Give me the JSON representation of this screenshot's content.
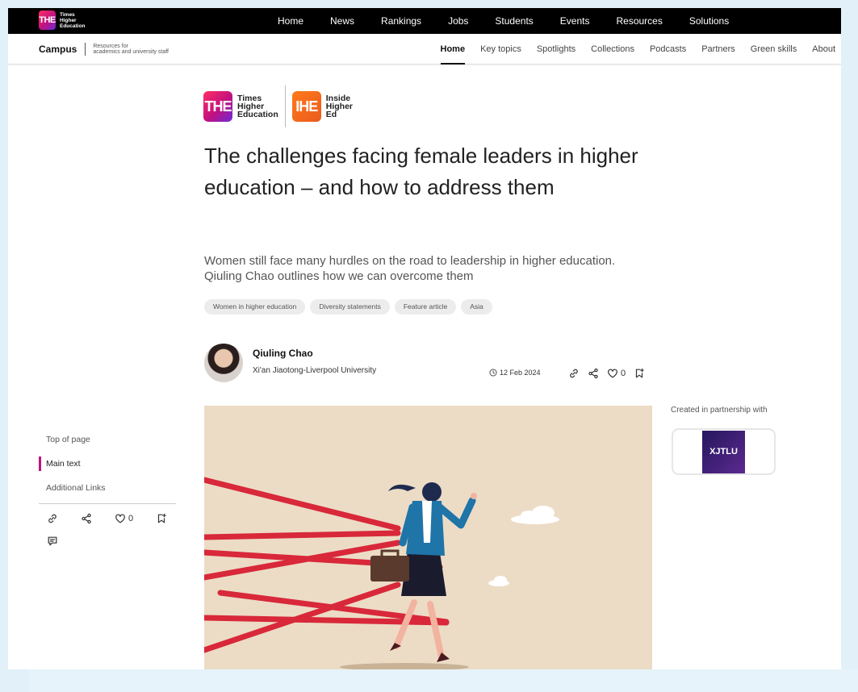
{
  "topbar": {
    "logo_mark": "THE",
    "logo_lines": [
      "Times",
      "Higher",
      "Education"
    ],
    "nav": [
      "Home",
      "News",
      "Rankings",
      "Jobs",
      "Students",
      "Events",
      "Resources",
      "Solutions"
    ]
  },
  "subbar": {
    "campus": "Campus",
    "tagline": [
      "Resources for",
      "academics and university staff"
    ],
    "nav": [
      "Home",
      "Key topics",
      "Spotlights",
      "Collections",
      "Podcasts",
      "Partners",
      "Green skills",
      "About"
    ],
    "active": "Home"
  },
  "article": {
    "logos": {
      "the_mark": "THE",
      "the_words": [
        "Times",
        "Higher",
        "Education"
      ],
      "ihe_mark": "IHE",
      "ihe_words": [
        "Inside",
        "Higher",
        "Ed"
      ]
    },
    "title": "The challenges facing female leaders in higher education – and how to address them",
    "standfirst": "Women still face many hurdles on the road to leadership in higher education. Qiuling Chao outlines how we can overcome them",
    "tags": [
      "Women in higher education",
      "Diversity statements",
      "Feature article",
      "Asia"
    ],
    "author": {
      "name": "Qiuling Chao",
      "institution": "Xi'an Jiaotong-Liverpool University"
    },
    "date": "12 Feb 2024",
    "like_count": "0"
  },
  "partner": {
    "label": "Created in partnership with",
    "logo_text": "XJTLU"
  },
  "rail": {
    "items": [
      "Top of page",
      "Main text",
      "Additional Links"
    ],
    "active": "Main text",
    "like_count": "0"
  },
  "colors": {
    "accent": "#c1117f",
    "the_gradient_start": "#ff2e63",
    "ihe_orange": "#ea5a1f",
    "hero_bg": "#ecdcc6",
    "rope_red": "#d8283a"
  },
  "icons": [
    "link-icon",
    "share-icon",
    "heart-icon",
    "bookmark-icon",
    "comment-icon",
    "clock-icon"
  ]
}
